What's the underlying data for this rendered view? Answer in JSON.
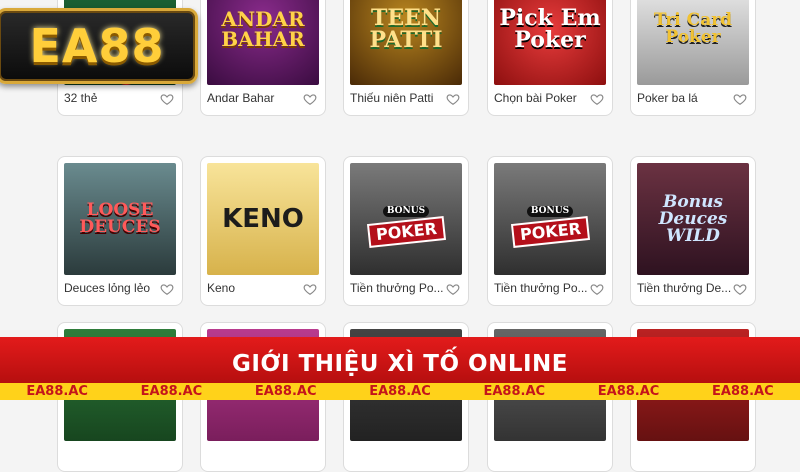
{
  "logo": {
    "text": "EA88"
  },
  "games": [
    {
      "caption": "32 thẻ",
      "art": ""
    },
    {
      "caption": "Andar Bahar",
      "art": "ANDAR BAHAR"
    },
    {
      "caption": "Thiếu niên Patti",
      "art": "TEEN PATTI"
    },
    {
      "caption": "Chọn bài Poker",
      "art": "Pick Em Poker"
    },
    {
      "caption": "Poker ba lá",
      "art": "Tri Card Poker"
    },
    {
      "caption": "Deuces lỏng lẻo",
      "art": "LOOSE DEUCES"
    },
    {
      "caption": "Keno",
      "art": "KENO"
    },
    {
      "caption": "Tiền thưởng Po...",
      "art": "POKER",
      "tag": "BONUS"
    },
    {
      "caption": "Tiền thưởng Po...",
      "art": "POKER",
      "tag": "BONUS"
    },
    {
      "caption": "Tiền thưởng De...",
      "art": "Bonus Deuces WILD"
    }
  ],
  "banner": {
    "title": "GIỚI THIỆU XÌ TỐ ONLINE"
  },
  "ticker": [
    "EA88.AC",
    "EA88.AC",
    "EA88.AC",
    "EA88.AC",
    "EA88.AC",
    "EA88.AC",
    "EA88.AC"
  ],
  "colors": {
    "banner_red": "#e31b1b",
    "ticker_yellow": "#ffd21a",
    "logo_gold": "#ffce3a"
  },
  "icons": {
    "favorite": "heart-outline-icon"
  }
}
